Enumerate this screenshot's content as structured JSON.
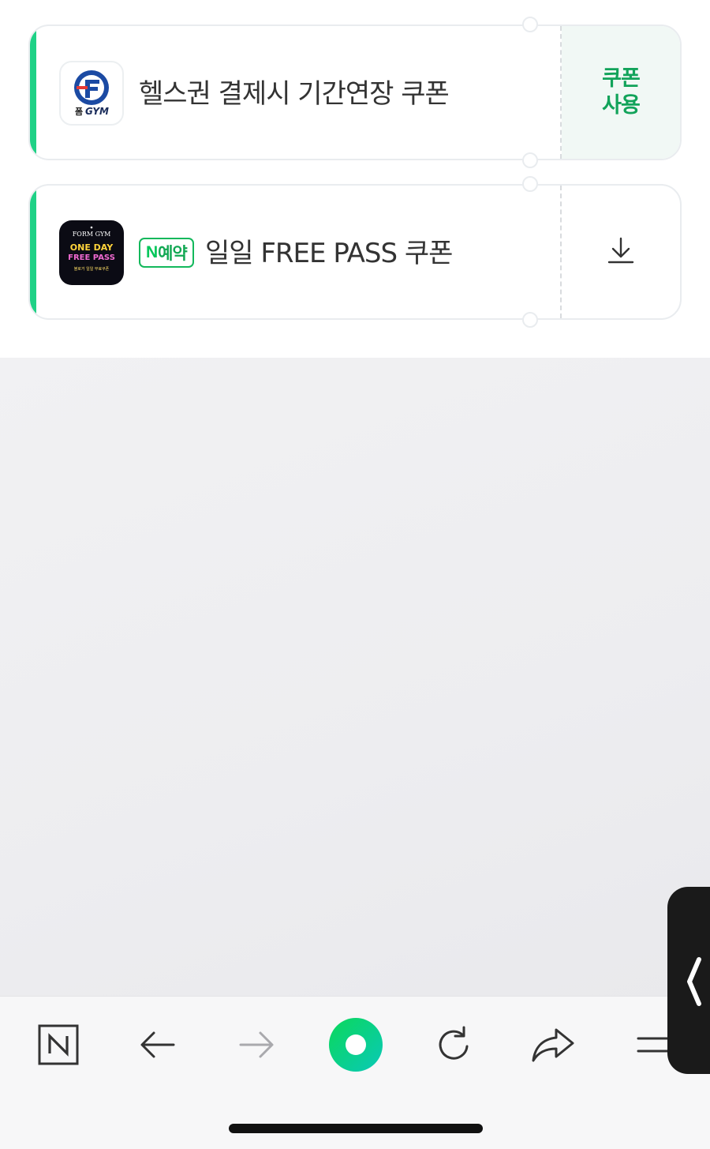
{
  "coupons": [
    {
      "brand_logo_text": "GYM",
      "brand_logo_prefix": "폼",
      "title": "헬스권 결제시 기간연장 쿠폰",
      "action_line1": "쿠폰",
      "action_line2": "사용",
      "accent_color": "#1fd186"
    },
    {
      "logo_line1": "FORM GYM",
      "logo_line2": "ONE DAY",
      "logo_line3": "FREE PASS",
      "logo_line4": "블로거 일일 무료쿠폰",
      "badge_letter": "N",
      "badge_text": "예약",
      "title": "일일 FREE PASS 쿠폰",
      "action_icon": "download-icon"
    }
  ],
  "toolbar": {
    "icons": [
      "naver-n-icon",
      "back-arrow-icon",
      "forward-arrow-icon",
      "green-dot-icon",
      "refresh-icon",
      "share-icon",
      "menu-icon"
    ],
    "n_letter": "N"
  },
  "colors": {
    "accent_green": "#1fd186",
    "action_green": "#12a35a",
    "toolbar_bg": "#f7f7f8"
  }
}
